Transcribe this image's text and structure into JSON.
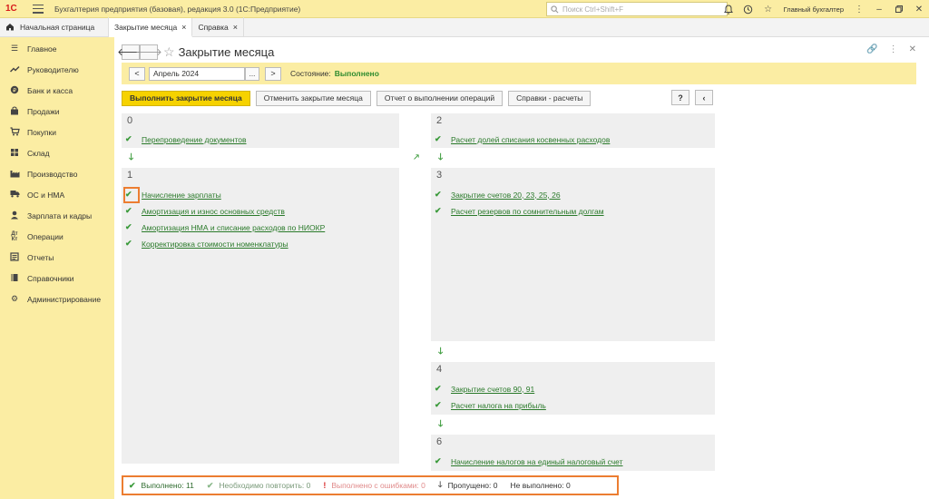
{
  "app": {
    "logo_text": "1С",
    "title": "Бухгалтерия предприятия (базовая), редакция 3.0  (1С:Предприятие)",
    "search_placeholder": "Поиск Ctrl+Shift+F",
    "user": "Главный бухгалтер"
  },
  "tabs": [
    {
      "label": "Начальная страница"
    },
    {
      "label": "Закрытие месяца"
    },
    {
      "label": "Справка"
    }
  ],
  "sidebar": {
    "items": [
      {
        "label": "Главное",
        "icon": "list-icon"
      },
      {
        "label": "Руководителю",
        "icon": "trend-icon"
      },
      {
        "label": "Банк и касса",
        "icon": "coin-icon"
      },
      {
        "label": "Продажи",
        "icon": "bag-icon"
      },
      {
        "label": "Покупки",
        "icon": "cart-icon"
      },
      {
        "label": "Склад",
        "icon": "warehouse-icon"
      },
      {
        "label": "Производство",
        "icon": "factory-icon"
      },
      {
        "label": "ОС и НМА",
        "icon": "truck-icon"
      },
      {
        "label": "Зарплата и кадры",
        "icon": "person-icon"
      },
      {
        "label": "Операции",
        "icon": "operations-icon"
      },
      {
        "label": "Отчеты",
        "icon": "report-icon"
      },
      {
        "label": "Справочники",
        "icon": "book-icon"
      },
      {
        "label": "Администрирование",
        "icon": "gear-icon"
      }
    ]
  },
  "page": {
    "title": "Закрытие месяца",
    "period": "Апрель 2024",
    "state_label": "Состояние:",
    "state_value": "Выполнено"
  },
  "actions": {
    "run": "Выполнить закрытие месяца",
    "cancel": "Отменить закрытие месяца",
    "report": "Отчет о выполнении операций",
    "refs": "Справки - расчеты",
    "help": "?",
    "collapse": "‹"
  },
  "stages": {
    "s0": {
      "num": "0",
      "ops": [
        "Перепроведение документов"
      ]
    },
    "s1": {
      "num": "1",
      "ops": [
        "Начисление зарплаты",
        "Амортизация и износ основных средств",
        "Амортизация НМА и списание расходов по НИОКР",
        "Корректировка стоимости номенклатуры"
      ]
    },
    "s2": {
      "num": "2",
      "ops": [
        "Расчет долей списания косвенных расходов"
      ]
    },
    "s3": {
      "num": "3",
      "ops": [
        "Закрытие счетов 20, 23, 25, 26",
        "Расчет резервов по сомнительным долгам"
      ]
    },
    "s4": {
      "num": "4",
      "ops": [
        "Закрытие счетов 90, 91",
        "Расчет налога на прибыль"
      ]
    },
    "s6": {
      "num": "6",
      "ops": [
        "Начисление налогов на единый налоговый счет"
      ]
    }
  },
  "status": {
    "done": "Выполнено: 11",
    "repeat": "Необходимо повторить: 0",
    "errors": "Выполнено с ошибками: 0",
    "skipped": "Пропущено: 0",
    "notdone": "Не выполнено: 0"
  },
  "colors": {
    "accent_yellow": "#fbeda3",
    "primary_button": "#f6d200",
    "success_green": "#3a9a3a",
    "error_red": "#d92b2b",
    "highlight_orange": "#ec7d31"
  }
}
